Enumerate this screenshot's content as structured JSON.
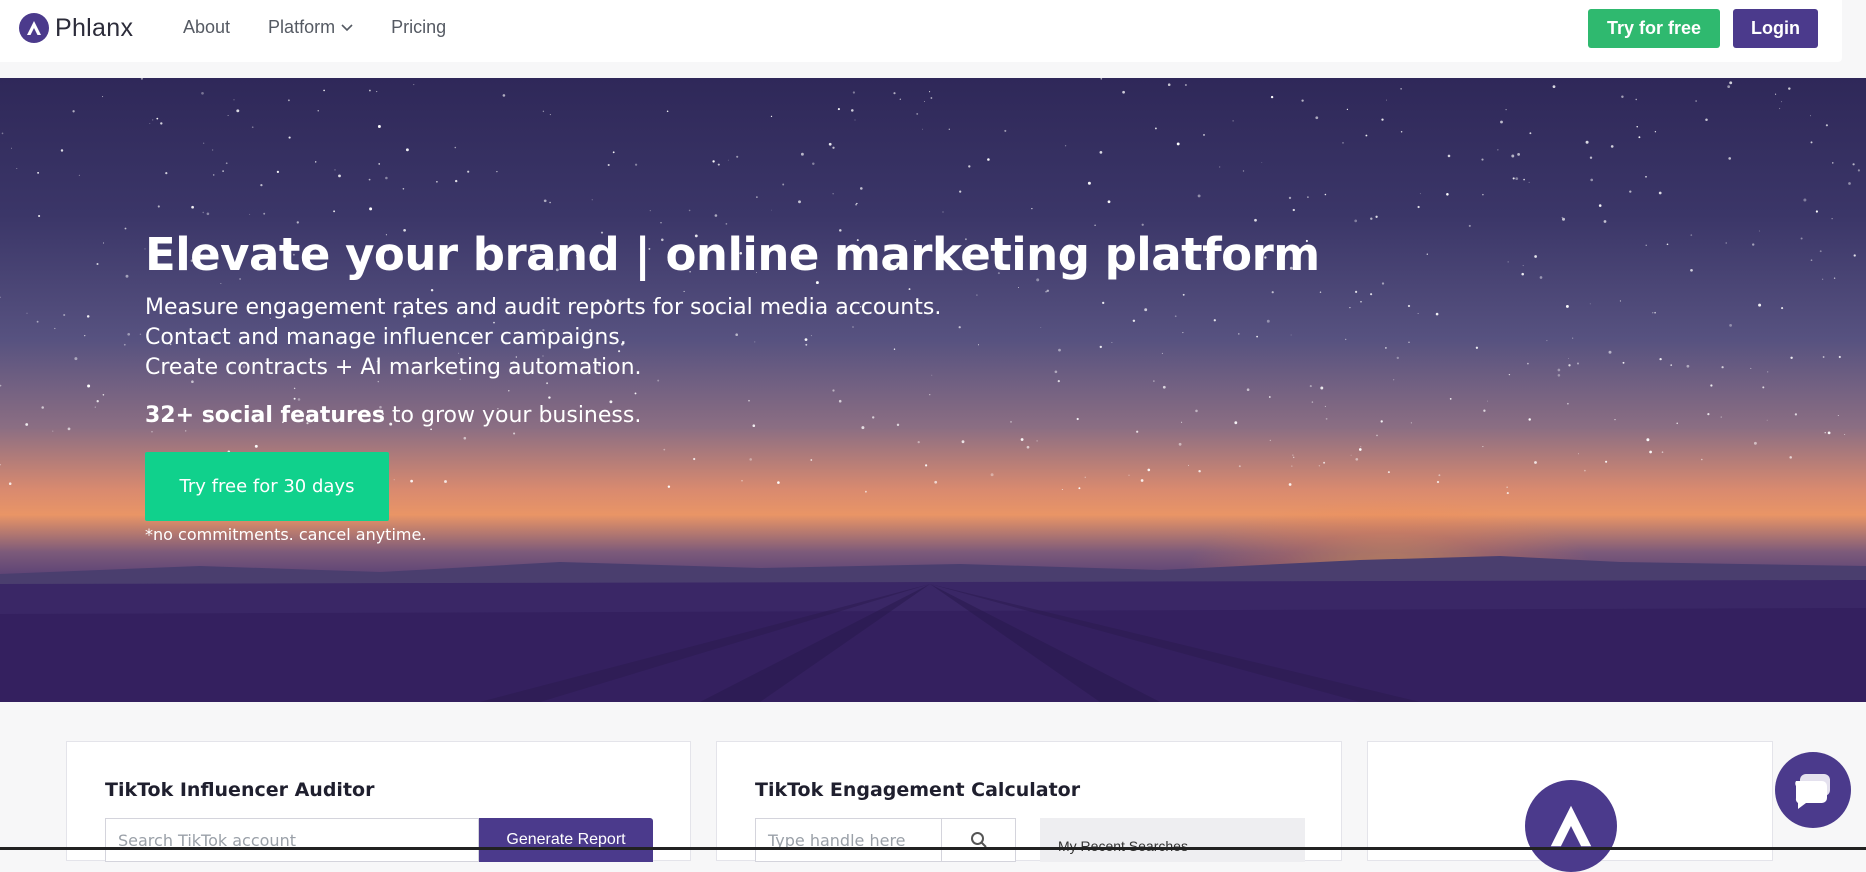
{
  "nav": {
    "logo_text": "Phlanx",
    "links": [
      {
        "label": "About"
      },
      {
        "label": "Platform"
      },
      {
        "label": "Pricing"
      }
    ],
    "try_label": "Try for free",
    "login_label": "Login",
    "colors": {
      "accent": "#4b3a8c",
      "try_green": "#2fb96f"
    }
  },
  "hero": {
    "headline": "Elevate your brand | online marketing platform",
    "lines": [
      "Measure engagement rates and audit reports for social media accounts.",
      "Contact and manage influencer campaigns.",
      "Create contracts + AI marketing automation."
    ],
    "features_bold": "32+ social features",
    "features_rest": " to grow your business.",
    "cta_label": "Try free for 30 days",
    "note": "*no commitments. cancel anytime.",
    "cta_color": "#10d18c"
  },
  "cards": {
    "auditor": {
      "title": "TikTok Influencer Auditor",
      "placeholder": "Search TikTok account",
      "button_label": "Generate Report"
    },
    "engagement": {
      "title": "TikTok Engagement Calculator",
      "placeholder": "Type handle here",
      "search_icon": "search-icon",
      "recent_label": "My Recent Searches"
    },
    "brand": {
      "avatar_icon": "phlanx-logo-icon"
    }
  },
  "chat": {
    "icon": "chat-bubble-icon"
  }
}
